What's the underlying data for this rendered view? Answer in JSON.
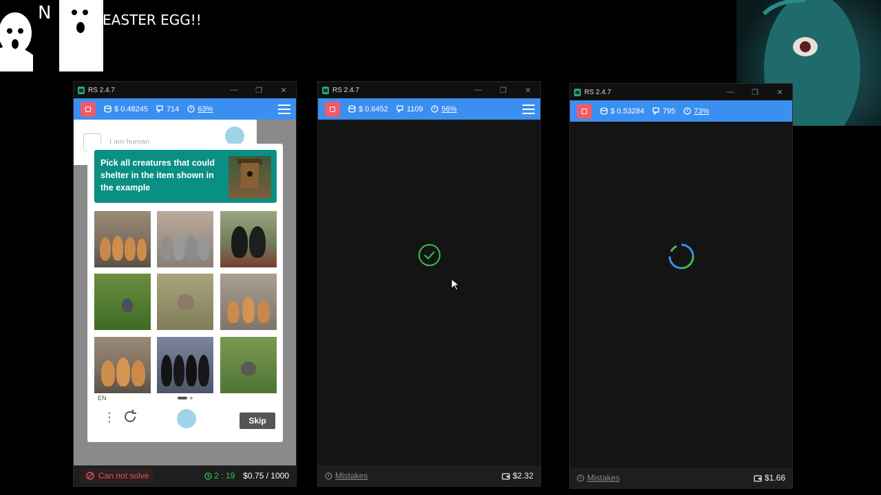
{
  "overlay": {
    "meme_letter": "N",
    "title": "EASTER EGG!!"
  },
  "windows": [
    {
      "title": "RS 2.4.7",
      "balance": "$ 0.48245",
      "count": "714",
      "percent": "63%",
      "captcha": {
        "checkbox_label": "I am human",
        "prompt": "Pick all creatures that could shelter in the item shown in the example",
        "language": "EN",
        "skip_label": "Skip",
        "tiles": [
          "orange-cats",
          "gray-cats",
          "black-cats",
          "bird",
          "sparrow",
          "orange-cats",
          "orange-cats",
          "black-cats",
          "bird"
        ]
      },
      "footer": {
        "status": "Can not solve",
        "timer": "2 : 19",
        "price": "$0.75 / 1000"
      }
    },
    {
      "title": "RS 2.4.7",
      "balance": "$ 0.6452",
      "count": "1109",
      "percent": "56%",
      "footer": {
        "mistakes": "Mistakes",
        "wallet": "$2.32"
      }
    },
    {
      "title": "RS 2.4.7",
      "balance": "$ 0.53284",
      "count": "795",
      "percent": "73%",
      "footer": {
        "mistakes": "Mistakes",
        "wallet": "$1.66"
      }
    }
  ],
  "colors": {
    "accent_blue": "#3a8ff0",
    "stop_red": "#ef5b6a",
    "teal_prompt": "#0a8f84",
    "success_green": "#39c24a",
    "error_red": "#e65454"
  },
  "icons": [
    "app-icon",
    "minimize-icon",
    "maximize-icon",
    "close-icon",
    "stop-icon",
    "coins-icon",
    "messages-icon",
    "clock-icon",
    "hamburger-icon",
    "info-icon",
    "wallet-icon",
    "check-circle-icon",
    "spinner-icon",
    "refresh-icon",
    "kebab-icon",
    "hcaptcha-logo-icon",
    "cursor-icon",
    "ban-icon"
  ]
}
